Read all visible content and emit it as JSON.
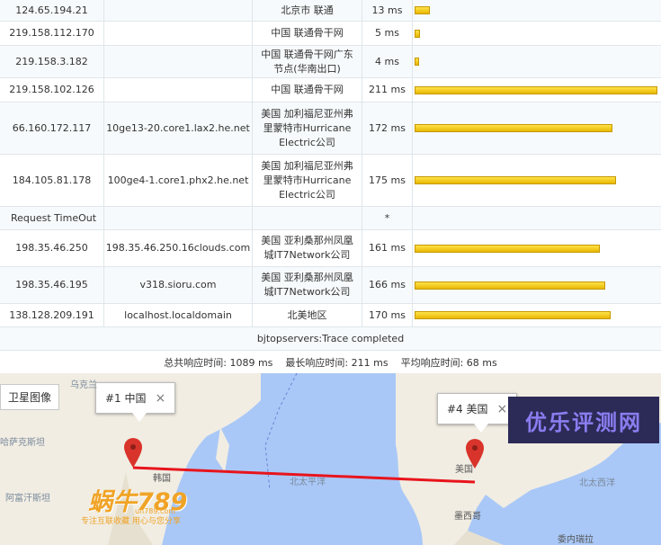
{
  "hops": [
    {
      "ip": "124.65.194.21",
      "host": "",
      "location": "北京市 联通",
      "ms": "13 ms",
      "latency": 13
    },
    {
      "ip": "219.158.112.170",
      "host": "",
      "location": "中国 联通骨干网",
      "ms": "5 ms",
      "latency": 5
    },
    {
      "ip": "219.158.3.182",
      "host": "",
      "location": "中国 联通骨干网广东节点(华南出口)",
      "ms": "4 ms",
      "latency": 4
    },
    {
      "ip": "219.158.102.126",
      "host": "",
      "location": "中国 联通骨干网",
      "ms": "211 ms",
      "latency": 211
    },
    {
      "ip": "66.160.172.117",
      "host": "10ge13-20.core1.lax2.he.net",
      "location": "美国 加利福尼亚州弗里蒙特市Hurricane Electric公司",
      "ms": "172 ms",
      "latency": 172
    },
    {
      "ip": "184.105.81.178",
      "host": "100ge4-1.core1.phx2.he.net",
      "location": "美国 加利福尼亚州弗里蒙特市Hurricane Electric公司",
      "ms": "175 ms",
      "latency": 175
    },
    {
      "ip": "Request TimeOut",
      "host": "",
      "location": "",
      "ms": "*",
      "latency": 0,
      "timeout": true
    },
    {
      "ip": "198.35.46.250",
      "host": "198.35.46.250.16clouds.com",
      "location": "美国 亚利桑那州凤凰城IT7Network公司",
      "ms": "161 ms",
      "latency": 161
    },
    {
      "ip": "198.35.46.195",
      "host": "v318.sioru.com",
      "location": "美国 亚利桑那州凤凰城IT7Network公司",
      "ms": "166 ms",
      "latency": 166
    },
    {
      "ip": "138.128.209.191",
      "host": "localhost.localdomain",
      "location": "北美地区",
      "ms": "170 ms",
      "latency": 170
    }
  ],
  "max_latency": 211,
  "status_text": "bjtopservers:Trace completed",
  "summary": {
    "total_label": "总共响应时间:",
    "total_value": "1089 ms",
    "max_label": "最长响应时间:",
    "max_value": "211 ms",
    "avg_label": "平均响应时间:",
    "avg_value": "68 ms"
  },
  "map": {
    "satellite_button": "卫星图像",
    "popup_china": "#1 中国",
    "popup_usa": "#4 美国",
    "close_glyph": "×",
    "labels": {
      "ukraine": "乌克兰",
      "kazakhstan": "哈萨克斯坦",
      "afghanistan": "阿富汗斯坦",
      "korea": "韩国",
      "pacific": "北太平洋",
      "atlantic": "北太西洋",
      "usa": "美国",
      "mexico": "墨西哥",
      "venezuela": "委内瑞拉"
    },
    "watermark_right": "优乐评测网",
    "logo_text": "蜗牛789",
    "logo_url": "un789.com",
    "logo_slogan": "专注互联收藏   用心与您分享"
  },
  "colors": {
    "bar": "#f5c400",
    "route": "#e8141c",
    "pin": "#d9342b",
    "water": "#a9c8f7",
    "land": "#f1ede3"
  }
}
